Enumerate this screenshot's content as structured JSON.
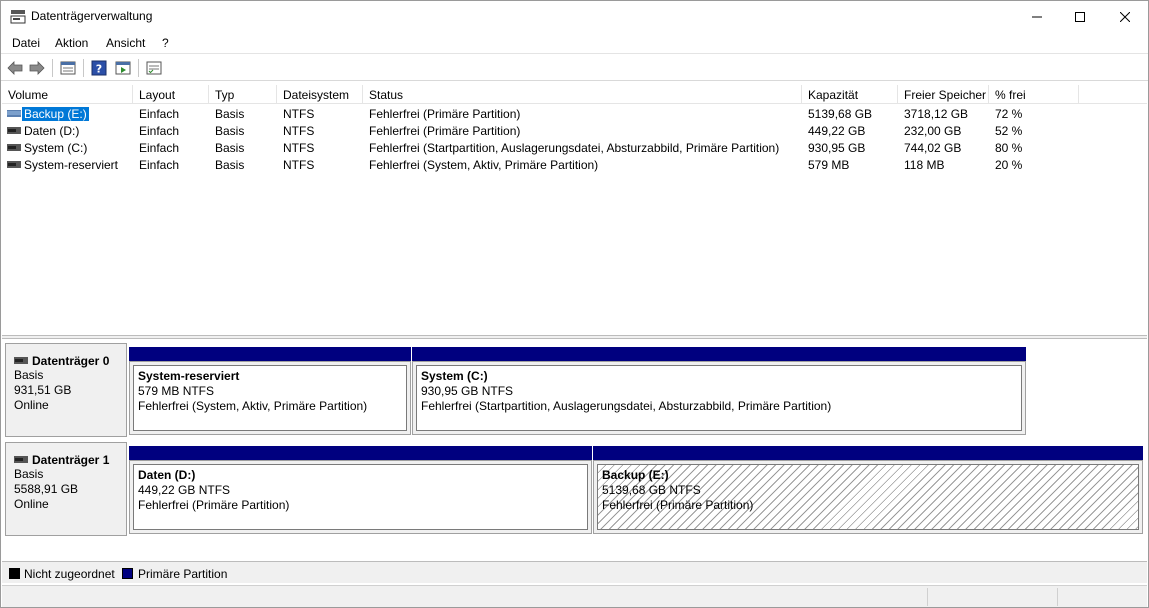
{
  "window": {
    "title": "Datenträgerverwaltung"
  },
  "menu": [
    "Datei",
    "Aktion",
    "Ansicht",
    "?"
  ],
  "toolbar": {
    "icons": [
      "back-arrow-icon",
      "forward-arrow-icon",
      "properties-icon",
      "help-icon",
      "console-tree-icon",
      "list-view-icon"
    ]
  },
  "volume_list": {
    "columns": [
      "Volume",
      "Layout",
      "Typ",
      "Dateisystem",
      "Status",
      "Kapazität",
      "Freier Speicher",
      "% frei"
    ],
    "rows": [
      {
        "volume": "Backup (E:)",
        "layout": "Einfach",
        "typ": "Basis",
        "fs": "NTFS",
        "status": "Fehlerfrei (Primäre Partition)",
        "capacity": "5139,68 GB",
        "free": "3718,12 GB",
        "pct": "72 %",
        "selected": true
      },
      {
        "volume": "Daten (D:)",
        "layout": "Einfach",
        "typ": "Basis",
        "fs": "NTFS",
        "status": "Fehlerfrei (Primäre Partition)",
        "capacity": "449,22 GB",
        "free": "232,00 GB",
        "pct": "52 %",
        "selected": false
      },
      {
        "volume": "System (C:)",
        "layout": "Einfach",
        "typ": "Basis",
        "fs": "NTFS",
        "status": "Fehlerfrei (Startpartition, Auslagerungsdatei, Absturzabbild, Primäre Partition)",
        "capacity": "930,95 GB",
        "free": "744,02 GB",
        "pct": "80 %",
        "selected": false
      },
      {
        "volume": "System-reserviert",
        "layout": "Einfach",
        "typ": "Basis",
        "fs": "NTFS",
        "status": "Fehlerfrei (System, Aktiv, Primäre Partition)",
        "capacity": "579 MB",
        "free": "118 MB",
        "pct": "20 %",
        "selected": false
      }
    ]
  },
  "disks": [
    {
      "name": "Datenträger 0",
      "type": "Basis",
      "size": "931,51 GB",
      "state": "Online",
      "partitions": [
        {
          "name": "System-reserviert",
          "size_fs": "579 MB NTFS",
          "status": "Fehlerfrei (System, Aktiv, Primäre Partition)"
        },
        {
          "name": "System  (C:)",
          "size_fs": "930,95 GB NTFS",
          "status": "Fehlerfrei (Startpartition, Auslagerungsdatei, Absturzabbild, Primäre Partition)"
        }
      ]
    },
    {
      "name": "Datenträger 1",
      "type": "Basis",
      "size": "5588,91 GB",
      "state": "Online",
      "partitions": [
        {
          "name": "Daten  (D:)",
          "size_fs": "449,22 GB NTFS",
          "status": "Fehlerfrei (Primäre Partition)"
        },
        {
          "name": "Backup  (E:)",
          "size_fs": "5139,68 GB NTFS",
          "status": "Fehlerfrei (Primäre Partition)",
          "selected": true
        }
      ]
    }
  ],
  "legend": [
    {
      "label": "Nicht zugeordnet",
      "color": "#000000"
    },
    {
      "label": "Primäre Partition",
      "color": "#00007f"
    }
  ],
  "colors": {
    "primary_partition": "#00007f",
    "selection": "#0078d7"
  }
}
